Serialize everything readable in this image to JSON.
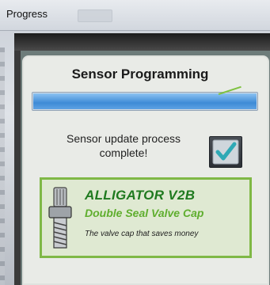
{
  "window": {
    "title": "Progress"
  },
  "panel": {
    "title": "Sensor Programming",
    "progress": 1.0,
    "status_line1": "Sensor update process",
    "status_line2": "complete!",
    "checkbox_checked": true
  },
  "ad": {
    "title": "ALLIGATOR V2B",
    "subtitle": "Double Seal Valve Cap",
    "tagline": "The valve cap that saves money",
    "icon": "valve-cap-icon"
  },
  "colors": {
    "accent_green": "#7fb846",
    "progress_blue": "#3e8bd6"
  }
}
